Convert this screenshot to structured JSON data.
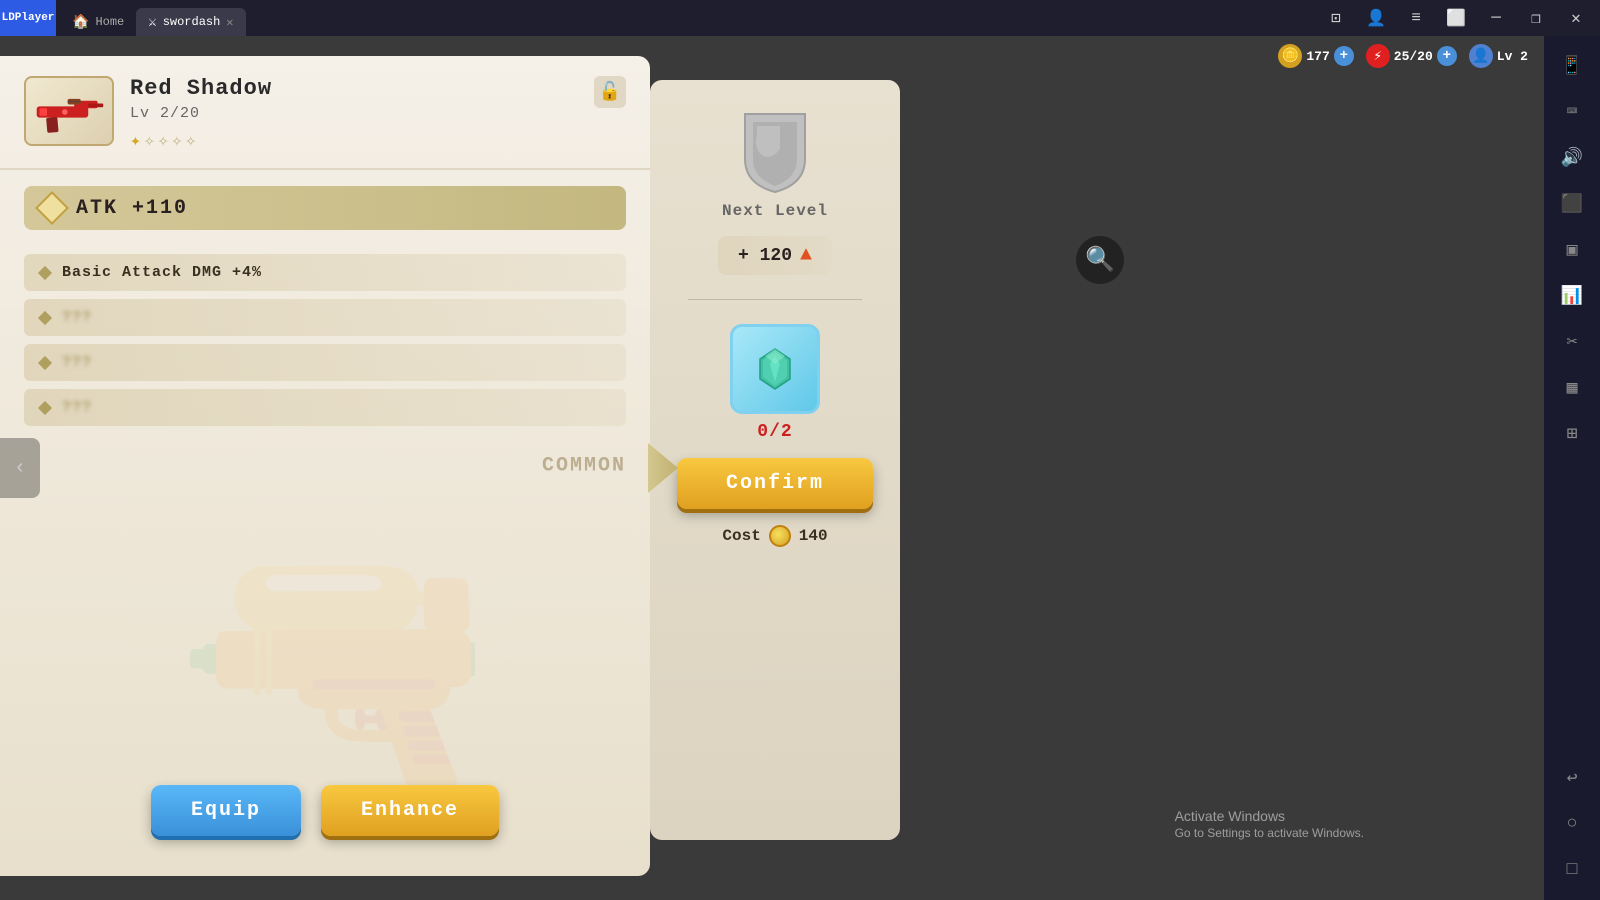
{
  "titlebar": {
    "logo": "LD",
    "tabs": [
      {
        "label": "Home",
        "icon": "🏠",
        "active": false
      },
      {
        "label": "swordash",
        "icon": "⚔",
        "active": true
      }
    ],
    "controls": [
      "⊟",
      "❐",
      "✕"
    ]
  },
  "hud": {
    "gold": "177",
    "energy": "25/20",
    "level": "Lv 2"
  },
  "weapon": {
    "name": "Red Shadow",
    "level": "Lv 2/20",
    "rarity": "COMMON",
    "stars": [
      true,
      false,
      false,
      false,
      false
    ],
    "atk": "ATK  +110",
    "stats": [
      {
        "label": "Basic Attack DMG +4%",
        "locked": false
      },
      {
        "label": "???",
        "locked": true
      },
      {
        "label": "???",
        "locked": true
      },
      {
        "label": "???",
        "locked": true
      }
    ]
  },
  "buttons": {
    "equip": "Equip",
    "enhance": "Enhance",
    "confirm": "Confirm"
  },
  "upgrade": {
    "next_level_label": "Next Level",
    "atk_increase": "+ 120",
    "crystal_count": "0/2",
    "cost_label": "Cost",
    "cost_amount": "140"
  },
  "activate_windows": {
    "line1": "Activate Windows",
    "line2": "Go to Settings to activate Windows."
  },
  "sidebar_icons": [
    "📱",
    "⌨",
    "📢",
    "⬛",
    "⬛",
    "📊",
    "✂",
    "⬛",
    "⬛"
  ]
}
